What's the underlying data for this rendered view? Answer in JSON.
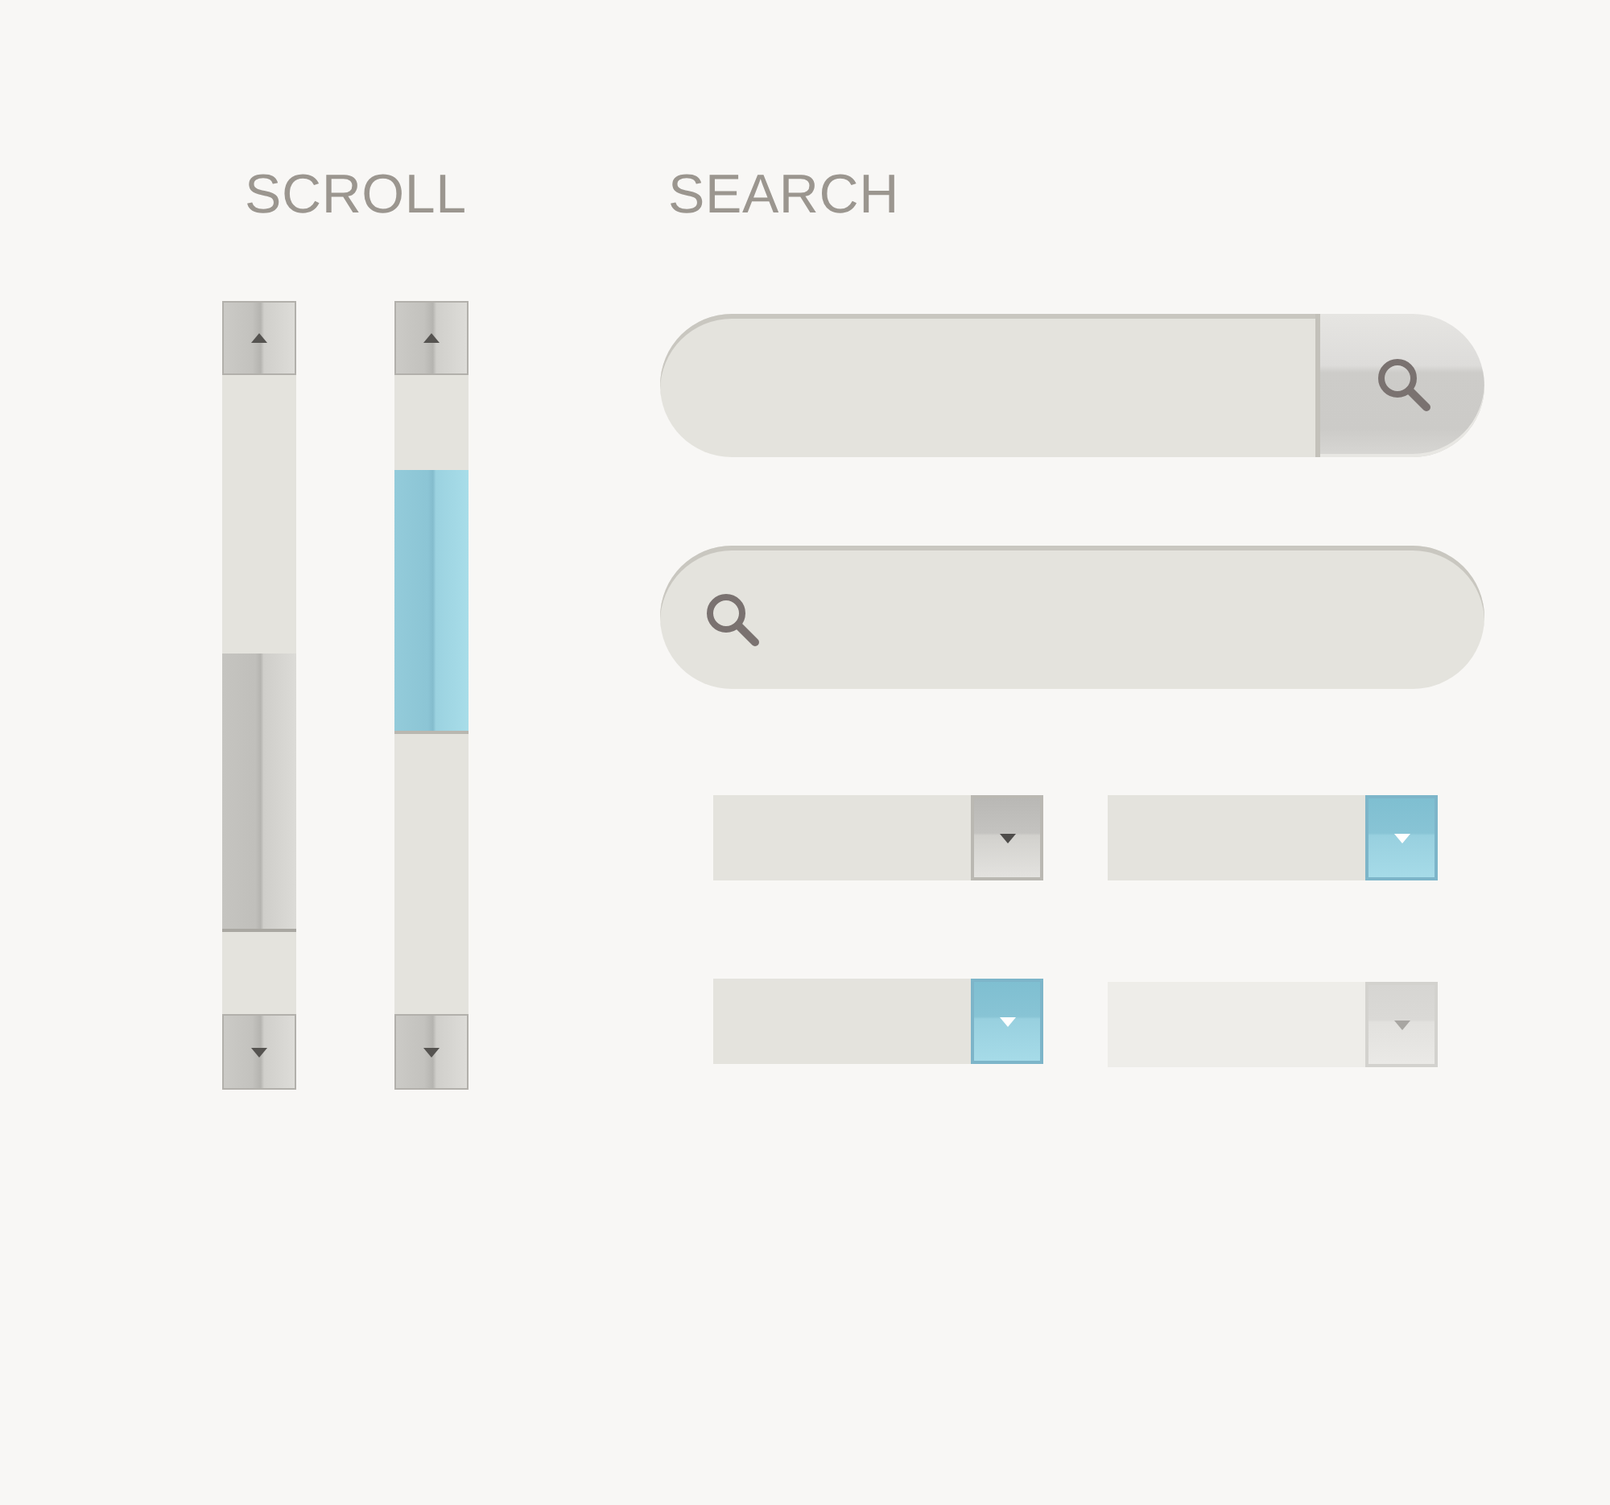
{
  "scroll": {
    "heading": "SCROLL",
    "scrollbars": [
      {
        "active": false
      },
      {
        "active": true
      }
    ]
  },
  "search": {
    "heading": "SEARCH",
    "fields": [
      {
        "kind": "button"
      },
      {
        "kind": "icon"
      }
    ]
  },
  "dropdowns": [
    {
      "active": false,
      "disabled": false
    },
    {
      "active": true,
      "disabled": false
    },
    {
      "active": true,
      "disabled": false
    },
    {
      "active": false,
      "disabled": true
    }
  ]
}
